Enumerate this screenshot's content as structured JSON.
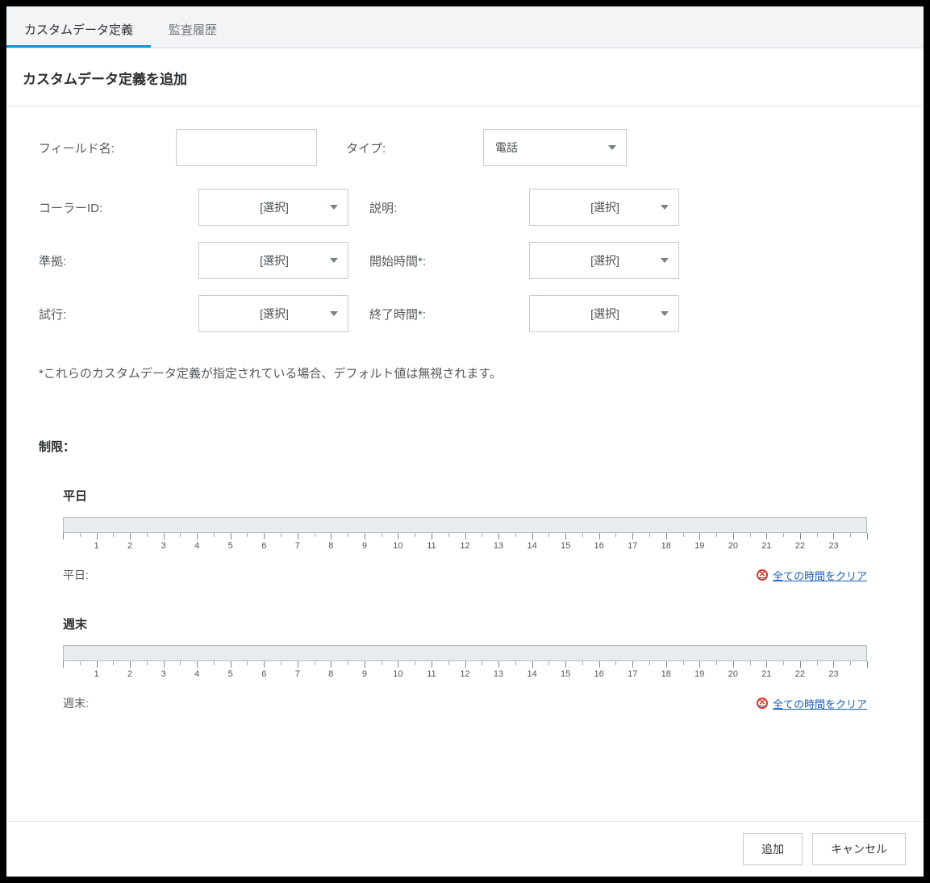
{
  "tabs": {
    "custom_data": "カスタムデータ定義",
    "audit": "監査履歴"
  },
  "page_title": "カスタムデータ定義を追加",
  "top": {
    "field_name_label": "フィールド名:",
    "field_name_value": "",
    "type_label": "タイプ:",
    "type_value": "電話"
  },
  "select_placeholder": "[選択]",
  "left_fields": {
    "caller_id": "コーラーID:",
    "compliance": "準拠:",
    "attempts": "試行:"
  },
  "right_fields": {
    "description": "説明:",
    "start_time": "開始時間*:",
    "end_time": "終了時間*:"
  },
  "note": "*これらのカスタムデータ定義が指定されている場合、デフォルト値は無視されます。",
  "restrictions_label": "制限：",
  "weekday": {
    "title": "平日",
    "footer_label": "平日:",
    "clear": "全ての時間をクリア"
  },
  "weekend": {
    "title": "週末",
    "footer_label": "週末:",
    "clear": "全ての時間をクリア"
  },
  "hours": [
    "1",
    "2",
    "3",
    "4",
    "5",
    "6",
    "7",
    "8",
    "9",
    "10",
    "11",
    "12",
    "13",
    "14",
    "15",
    "16",
    "17",
    "18",
    "19",
    "20",
    "21",
    "22",
    "23"
  ],
  "buttons": {
    "add": "追加",
    "cancel": "キャンセル"
  }
}
